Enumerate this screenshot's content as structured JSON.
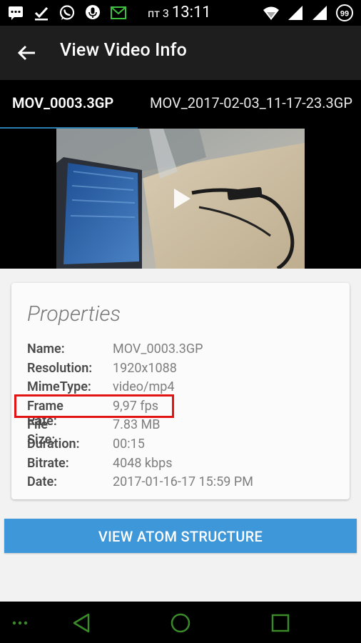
{
  "status_bar": {
    "day": "пт 3",
    "time": "13:11",
    "battery": "99",
    "icons_left": [
      "message-icon",
      "download-check-icon",
      "whatsapp-icon",
      "microphone-icon",
      "mail-icon"
    ],
    "icons_right": [
      "wifi-icon",
      "signal-icon",
      "signal-icon",
      "battery-icon"
    ]
  },
  "app_bar": {
    "title": "View Video Info"
  },
  "tabs": [
    {
      "label": "MOV_0003.3GP",
      "selected": true
    },
    {
      "label": "MOV_2017-02-03_11-17-23.3GP",
      "selected": false
    }
  ],
  "card": {
    "title": "Properties",
    "properties": [
      {
        "label": "Name:",
        "value": "MOV_0003.3GP"
      },
      {
        "label": "Resolution:",
        "value": "1920x1088"
      },
      {
        "label": "MimeType:",
        "value": "video/mp4"
      },
      {
        "label": "Frame Rate:",
        "value": "9,97 fps"
      },
      {
        "label": "File Size:",
        "value": "7.83 MB"
      },
      {
        "label": "Duration:",
        "value": "00:15"
      },
      {
        "label": "Bitrate:",
        "value": "4048 kbps"
      },
      {
        "label": "Date:",
        "value": "2017-01-16-17 15:59 PM"
      }
    ]
  },
  "button": {
    "label": "VIEW ATOM STRUCTURE"
  },
  "colors": {
    "accent": "#3d97d9",
    "tab_indicator": "#2a7fb0",
    "highlight": "#e21313",
    "nav_icon": "#3b8a2a"
  }
}
